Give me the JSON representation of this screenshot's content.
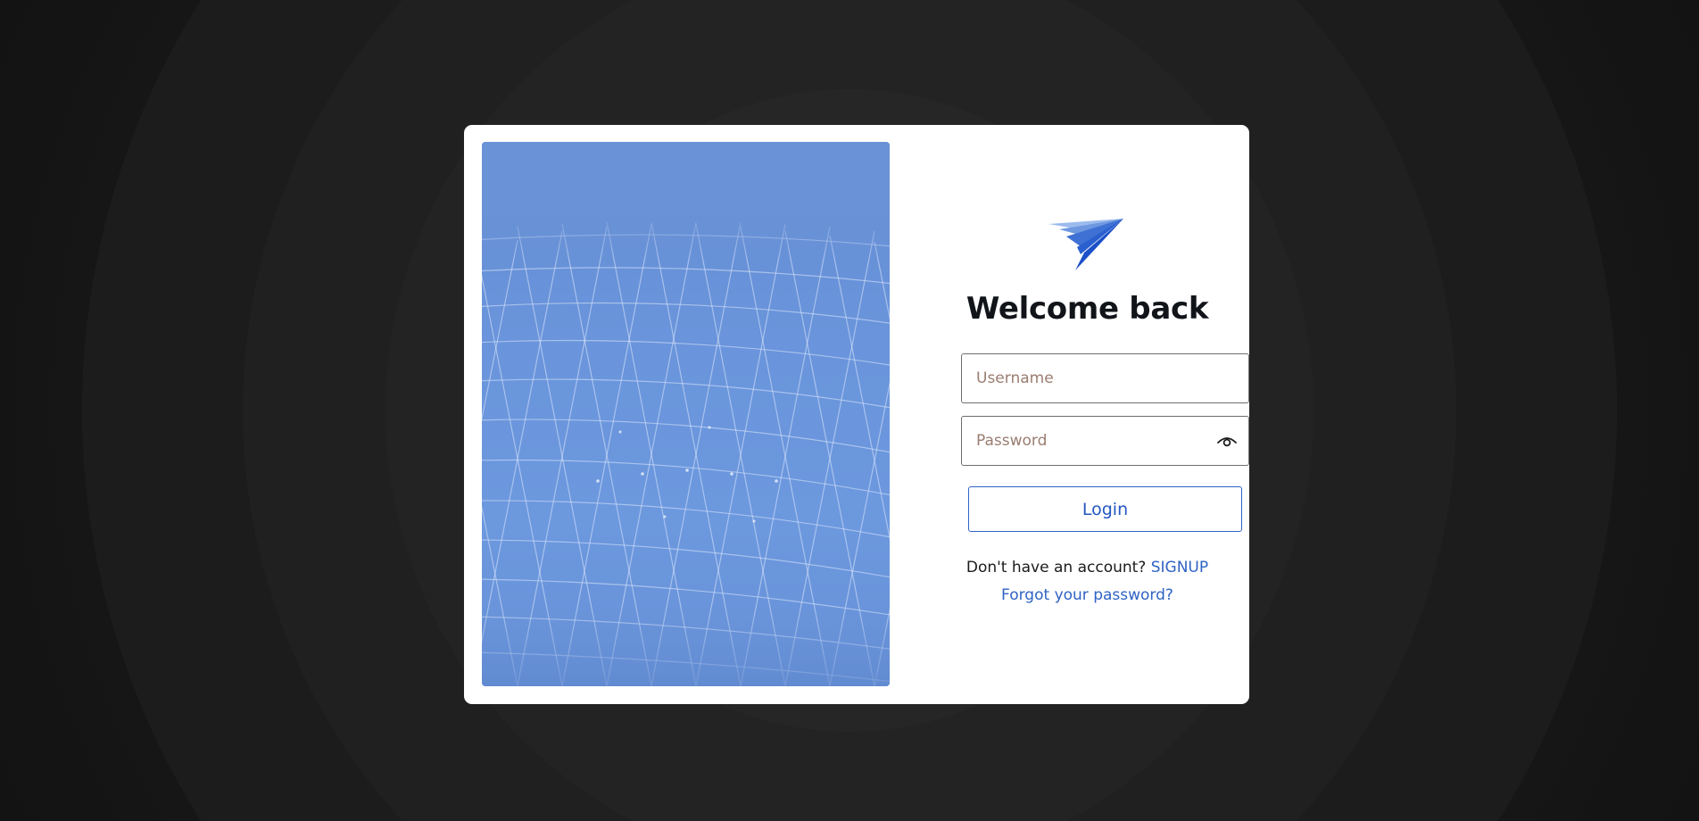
{
  "hero": {
    "image_description": "blue geometric mesh",
    "background_color": "#6a95dc"
  },
  "logo": {
    "icon": "paper-plane-logo-icon",
    "colors": [
      "#8fb2e8",
      "#5a86d6",
      "#2a5fcf",
      "#1a4fc6"
    ]
  },
  "title": "Welcome back",
  "username": {
    "placeholder": "Username",
    "value": ""
  },
  "password": {
    "placeholder": "Password",
    "value": "",
    "toggle_icon": "eye-icon"
  },
  "login_button": {
    "label": "Login",
    "color": "#2357c2"
  },
  "signup": {
    "prompt": "Don't have an account?",
    "link_label": "SIGNUP"
  },
  "forgot_password": {
    "label": "Forgot your password?"
  },
  "colors": {
    "accent": "#2f63c4",
    "card": "#ffffff",
    "page_background": "#1e1e1e"
  }
}
